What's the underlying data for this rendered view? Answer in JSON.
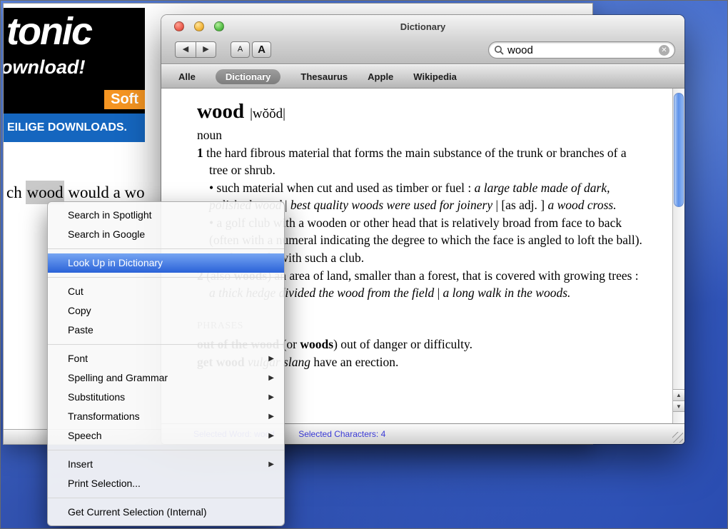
{
  "colors": {
    "desktop_blue": "#3f68cf",
    "menu_highlight": "#2a62d8",
    "close_button": "#ec5f50",
    "minimize_button": "#f2b63c",
    "zoom_button": "#57bf48",
    "banner_orange": "#f59522",
    "banner_blue": "#1566bf",
    "status_text": "#3a3ad6",
    "selection_grey": "#c9c9c9"
  },
  "background_window": {
    "banner": {
      "brand": "tonic",
      "line2": "ownload!",
      "tag": "Soft",
      "strip": "EILIGE DOWNLOADS."
    },
    "body": {
      "prefix": "ch ",
      "selected": "wood",
      "suffix": " would a wo"
    }
  },
  "dictionary_window": {
    "title": "Dictionary",
    "toolbar": {
      "back": "◀",
      "forward": "▶",
      "font_small": "A",
      "font_large": "A",
      "search": {
        "value": "wood",
        "clear": "✕"
      }
    },
    "tabs": [
      {
        "label": "Alle",
        "active": false
      },
      {
        "label": "Dictionary",
        "active": true
      },
      {
        "label": "Thesaurus",
        "active": false
      },
      {
        "label": "Apple",
        "active": false
      },
      {
        "label": "Wikipedia",
        "active": false
      }
    ],
    "content": {
      "headword": "wood",
      "pronunciation": "|wŏŏd|",
      "part_of_speech": "noun",
      "sense1": {
        "num": "1 ",
        "text": "the hard fibrous material that forms the main substance of the trunk or branches of a tree or shrub."
      },
      "bullet1": {
        "marker": "• ",
        "lead": "such material when cut and used as timber or fuel : ",
        "ex1": "a large table made of dark, polished wood",
        "sep1": " | ",
        "ex2": "best quality woods were used for joinery",
        "sep2": " | [as adj. ] ",
        "ex3": "a wood cross."
      },
      "bullet2": {
        "marker": "• ",
        "text": "a golf club with a wooden or other head that is relatively broad from face to back (often with a numeral indicating the degree to which the face is angled to loft the ball)."
      },
      "bullet3": {
        "marker": "• ",
        "text": "a shot made with such a club."
      },
      "sense2": {
        "num": "2 ",
        "pre": "(also ",
        "alt": "woods",
        "mid": ") an area of land, smaller than a forest, that is covered with growing trees : ",
        "ex1": "a thick hedge divided the wood from the field",
        "sep": " | ",
        "ex2": "a long walk in the woods."
      },
      "phrases_heading": "PHRASES",
      "phrase1": {
        "head": "out of the wood",
        "mid": " (or ",
        "alt": "woods",
        "tail": ") out of danger or difficulty."
      },
      "phrase2": {
        "head": "get wood",
        "label": " vulgar slang ",
        "tail": "have an erection."
      }
    },
    "scrollbar": {
      "up": "▲",
      "down": "▼"
    },
    "status": {
      "left": "Selected Word: wood",
      "right": "Selected Characters: 4"
    }
  },
  "context_menu": {
    "submenu_arrow": "▶",
    "items": [
      {
        "label": "Search in Spotlight"
      },
      {
        "label": "Search in Google"
      },
      {
        "type": "separator"
      },
      {
        "label": "Look Up in Dictionary",
        "highlighted": true
      },
      {
        "type": "separator"
      },
      {
        "label": "Cut"
      },
      {
        "label": "Copy"
      },
      {
        "label": "Paste"
      },
      {
        "type": "separator"
      },
      {
        "label": "Font",
        "submenu": true
      },
      {
        "label": "Spelling and Grammar",
        "submenu": true
      },
      {
        "label": "Substitutions",
        "submenu": true
      },
      {
        "label": "Transformations",
        "submenu": true
      },
      {
        "label": "Speech",
        "submenu": true
      },
      {
        "type": "separator"
      },
      {
        "label": "Insert",
        "submenu": true
      },
      {
        "label": "Print Selection..."
      },
      {
        "type": "separator"
      },
      {
        "label": "Get Current Selection (Internal)"
      }
    ]
  }
}
